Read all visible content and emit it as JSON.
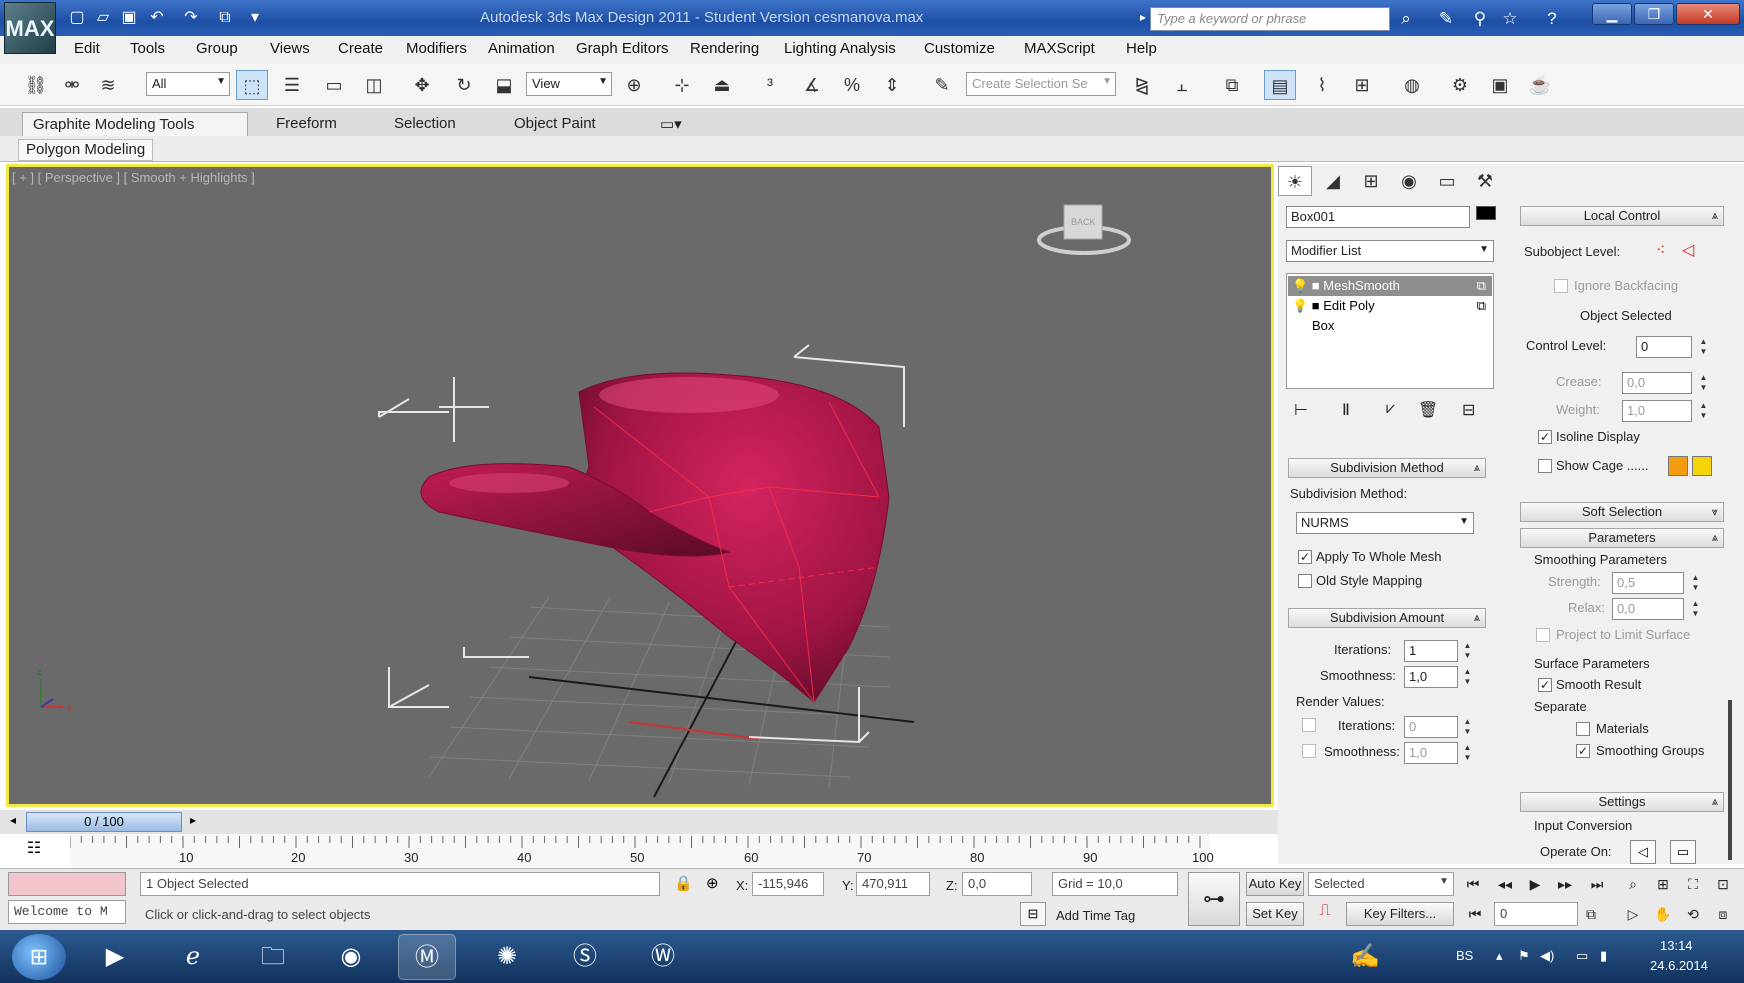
{
  "titlebar": {
    "logo_text": "MAX",
    "logo_sub": "3ds",
    "title": "Autodesk 3ds Max Design 2011 - Student Version   cesmanova.max",
    "search_placeholder": "Type a keyword or phrase"
  },
  "menu": [
    "Edit",
    "Tools",
    "Group",
    "Views",
    "Create",
    "Modifiers",
    "Animation",
    "Graph Editors",
    "Rendering",
    "Lighting Analysis",
    "Customize",
    "MAXScript",
    "Help"
  ],
  "toolbar": {
    "filter_value": "All",
    "refcoord_value": "View",
    "selection_set_placeholder": "Create Selection Se"
  },
  "ribbon": {
    "tabs": [
      "Graphite Modeling Tools",
      "Freeform",
      "Selection",
      "Object Paint"
    ],
    "panel_label": "Polygon Modeling"
  },
  "viewport": {
    "label": "[ + ] [ Perspective ] [ Smooth + Highlights ]",
    "viewcube_text": "BACK",
    "axis_z": "z",
    "axis_x": "x"
  },
  "command_panel": {
    "object_name": "Box001",
    "object_color": "#000000",
    "modifier_list": "Modifier List",
    "stack": [
      "MeshSmooth",
      "Edit Poly",
      "Box"
    ],
    "subdivision_method_title": "Subdivision Method",
    "subdivision_method_label": "Subdivision Method:",
    "subdivision_method_value": "NURMS",
    "apply_whole_mesh": "Apply To Whole Mesh",
    "old_style_mapping": "Old Style Mapping",
    "subdivision_amount_title": "Subdivision Amount",
    "iterations_label": "Iterations:",
    "iterations_value": "1",
    "smoothness_label": "Smoothness:",
    "smoothness_value": "1,0",
    "render_values_label": "Render Values:",
    "render_iterations_label": "Iterations:",
    "render_iterations_value": "0",
    "render_smoothness_label": "Smoothness:",
    "render_smoothness_value": "1,0",
    "local_control_title": "Local Control",
    "subobject_label": "Subobject Level:",
    "ignore_backfacing": "Ignore Backfacing",
    "object_selected": "Object Selected",
    "control_level_label": "Control Level:",
    "control_level_value": "0",
    "crease_label": "Crease:",
    "crease_value": "0,0",
    "weight_label": "Weight:",
    "weight_value": "1,0",
    "isoline_display": "Isoline Display",
    "show_cage": "Show Cage ......",
    "cage_color_1": "#f39c12",
    "cage_color_2": "#f5d50a",
    "soft_selection_title": "Soft Selection",
    "parameters_title": "Parameters",
    "smoothing_parameters": "Smoothing Parameters",
    "strength_label": "Strength:",
    "strength_value": "0,5",
    "relax_label": "Relax:",
    "relax_value": "0,0",
    "project_limit": "Project to Limit Surface",
    "surface_parameters": "Surface Parameters",
    "smooth_result": "Smooth Result",
    "separate_label": "Separate",
    "materials_label": "Materials",
    "smoothing_groups_label": "Smoothing Groups",
    "settings_title": "Settings",
    "input_conversion": "Input Conversion",
    "operate_on": "Operate On:"
  },
  "timeline": {
    "slider_label": "0 / 100",
    "ticks": [
      "10",
      "20",
      "30",
      "40",
      "50",
      "60",
      "70",
      "80",
      "90",
      "100"
    ]
  },
  "status": {
    "maxscript_text": "Welcome to M",
    "selection_info": "1 Object Selected",
    "prompt": "Click or click-and-drag to select objects",
    "x_label": "X:",
    "x_value": "-115,946",
    "y_label": "Y:",
    "y_value": "470,911",
    "z_label": "Z:",
    "z_value": "0,0",
    "grid": "Grid = 10,0",
    "add_time_tag": "Add Time Tag",
    "auto_key": "Auto Key",
    "set_key": "Set Key",
    "key_mode_value": "Selected",
    "key_filters": "Key Filters...",
    "frame_value": "0"
  },
  "taskbar": {
    "lang": "BS",
    "time": "13:14",
    "date": "24.6.2014"
  }
}
